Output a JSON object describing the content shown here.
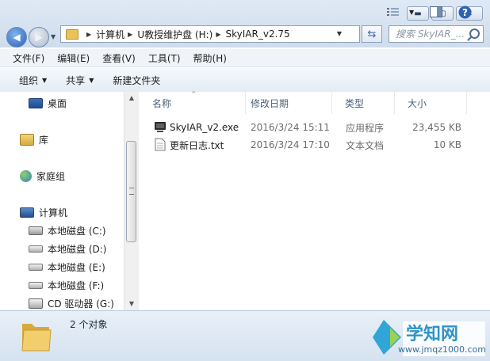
{
  "window": {
    "controls": {
      "minimize": "▬",
      "maximize": "▢",
      "close": "✕"
    }
  },
  "address": {
    "crumbs": [
      "计算机",
      "U教授维护盘 (H:)",
      "SkyIAR_v2.75"
    ]
  },
  "search": {
    "placeholder": "搜索 SkyIAR_..."
  },
  "menu": {
    "items": [
      "文件(F)",
      "编辑(E)",
      "查看(V)",
      "工具(T)",
      "帮助(H)"
    ]
  },
  "toolbar": {
    "organize": "组织",
    "share": "共享",
    "new_folder": "新建文件夹"
  },
  "sidebar": {
    "desktop": "桌面",
    "library": "库",
    "homegroup": "家庭组",
    "computer": "计算机",
    "drives": [
      "本地磁盘 (C:)",
      "本地磁盘 (D:)",
      "本地磁盘 (E:)",
      "本地磁盘 (F:)",
      "CD 驱动器 (G:)"
    ]
  },
  "columns": {
    "name": "名称",
    "date": "修改日期",
    "type": "类型",
    "size": "大小"
  },
  "files": [
    {
      "name": "SkyIAR_v2.exe",
      "date": "2016/3/24 15:11",
      "type": "应用程序",
      "size": "23,455 KB",
      "icon": "exe-icon"
    },
    {
      "name": "更新日志.txt",
      "date": "2016/3/24 17:10",
      "type": "文本文档",
      "size": "10 KB",
      "icon": "text-file-icon"
    }
  ],
  "status": {
    "count": "2 个对象"
  },
  "watermark": {
    "brand": "学知网",
    "url": "www.jmqz1000.com"
  }
}
